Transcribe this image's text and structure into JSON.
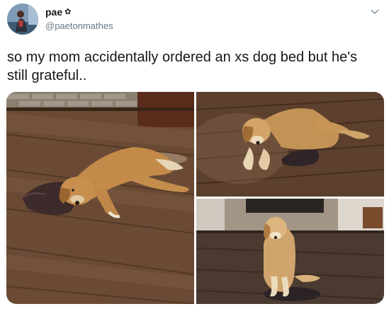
{
  "tweet": {
    "author": {
      "display_name": "pae",
      "badge_icon": "flower-icon",
      "handle": "@paetonmathes"
    },
    "menu_icon": "chevron-down-icon",
    "text": "so my mom accidentally ordered an xs dog bed but he's still grateful..",
    "media": [
      {
        "id": "photo-1",
        "subject": "golden retriever lying half on small dog bed on wood floor"
      },
      {
        "id": "photo-2",
        "subject": "golden retriever lying next to small dark dog bed"
      },
      {
        "id": "photo-3",
        "subject": "golden retriever sitting on small dog bed near fireplace"
      }
    ]
  },
  "colors": {
    "text": "#14171a",
    "secondary_text": "#657786",
    "floor_wood": "#6b4a34",
    "dog_fur": "#c08a4a"
  }
}
